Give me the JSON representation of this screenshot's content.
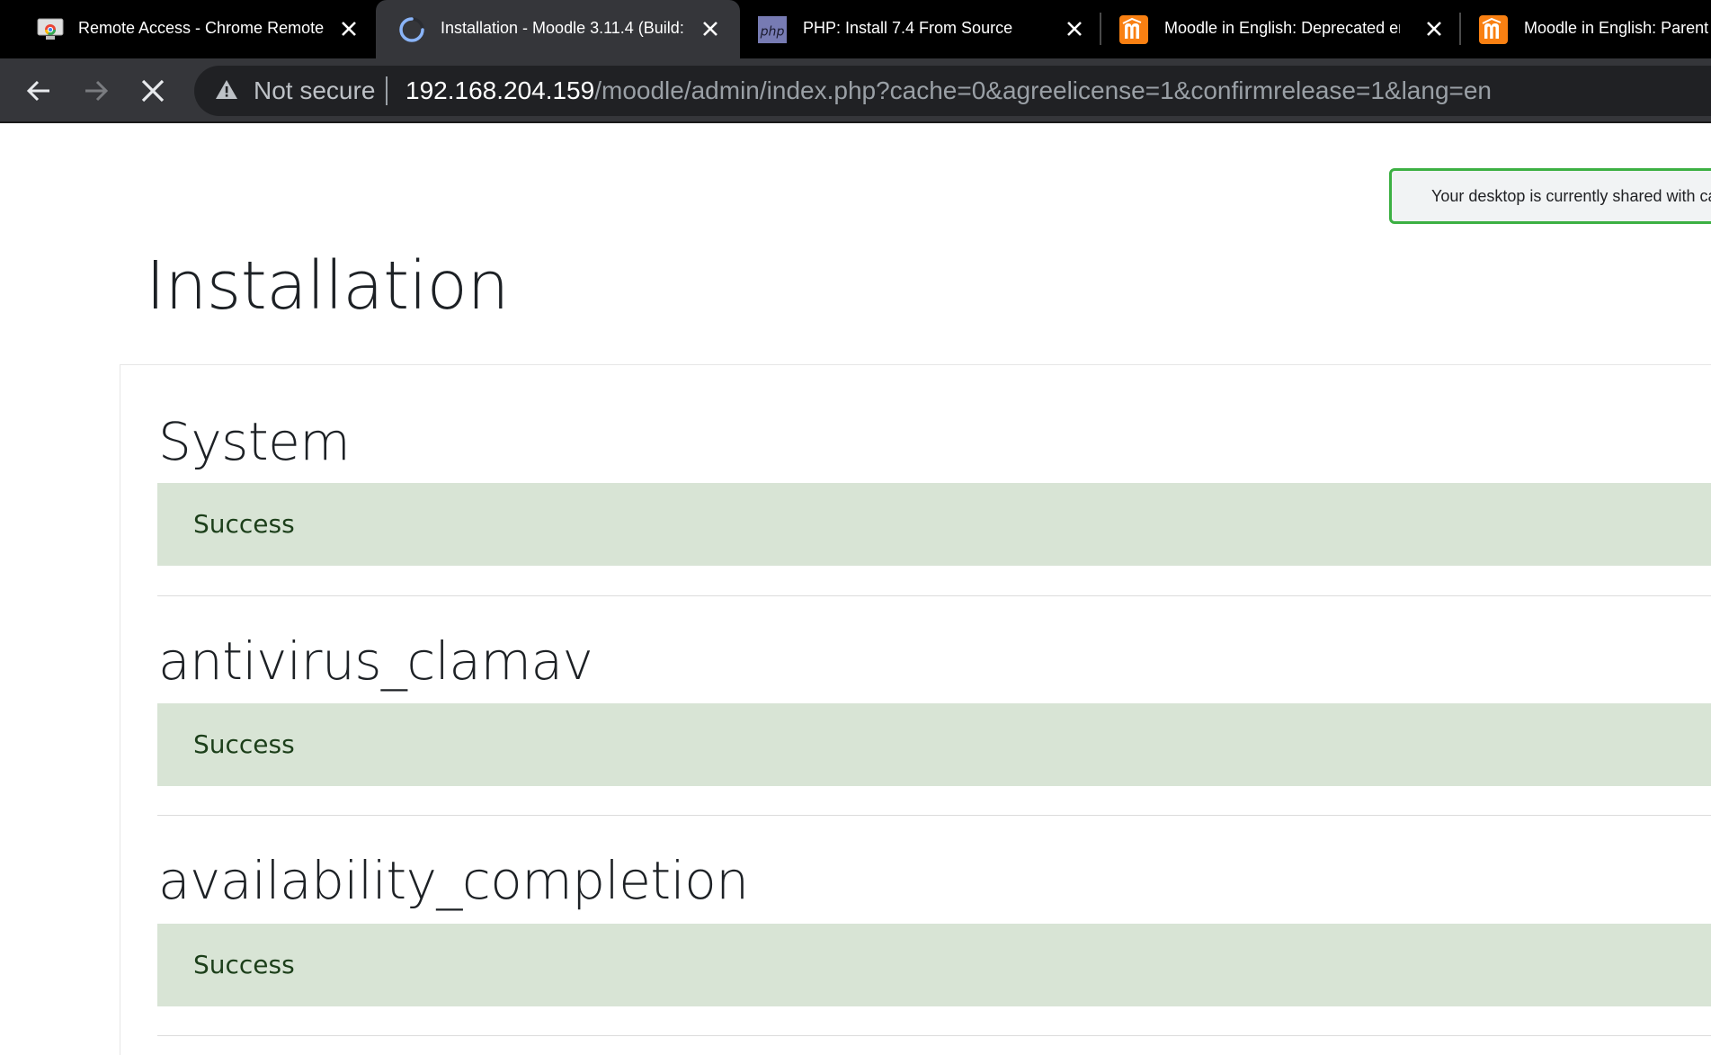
{
  "browser": {
    "tabs": [
      {
        "title": "Remote Access - Chrome Remote D",
        "icon": "chrome-remote-desktop-icon",
        "active": false
      },
      {
        "title": "Installation - Moodle 3.11.4 (Build:",
        "icon": "loading-spinner-icon",
        "active": true
      },
      {
        "title": "PHP: Install 7.4 From Source",
        "icon": "php-icon",
        "active": false
      },
      {
        "title": "Moodle in English: Deprecated erro",
        "icon": "moodle-icon",
        "active": false
      },
      {
        "title": "Moodle in English: Parent c",
        "icon": "moodle-icon",
        "active": false
      }
    ],
    "omnibox": {
      "security_label": "Not secure",
      "url_host": "192.168.204.159",
      "url_path": "/moodle/admin/index.php?cache=0&agreelicense=1&confirmrelease=1&lang=en"
    }
  },
  "notice": {
    "text": "Your desktop is currently shared with ca"
  },
  "page": {
    "title": "Installation",
    "sections": [
      {
        "title": "System",
        "status": "Success"
      },
      {
        "title": "antivirus_clamav",
        "status": "Success"
      },
      {
        "title": "availability_completion",
        "status": "Success"
      }
    ]
  },
  "colors": {
    "tabbar_bg": "#000000",
    "active_tab_bg": "#35363a",
    "success_bg": "#d8e4d5",
    "success_text": "#1c3f1a",
    "notice_border": "#3cb043",
    "moodle_orange": "#f98012"
  }
}
